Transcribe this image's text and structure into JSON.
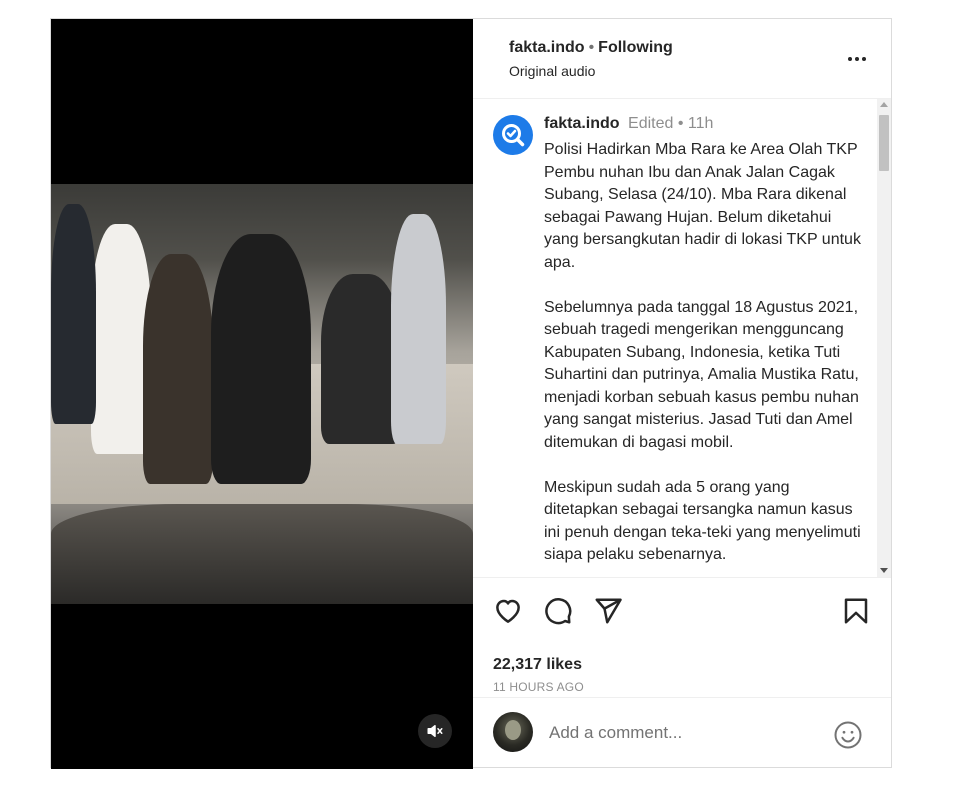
{
  "post": {
    "username": "fakta.indo",
    "follow_status": "Following",
    "separator": "•",
    "audio": "Original audio",
    "caption_edited": "Edited",
    "caption_time": "11h",
    "caption_paragraphs": [
      "Polisi Hadirkan Mba Rara ke Area Olah TKP Pembu nuhan Ibu dan Anak Jalan Cagak Subang, Selasa (24/10). Mba Rara dikenal sebagai Pawang Hujan. Belum diketahui yang bersangkutan hadir di lokasi TKP untuk apa.",
      "Sebelumnya pada tanggal 18 Agustus 2021, sebuah tragedi mengerikan mengguncang Kabupaten Subang, Indonesia, ketika Tuti Suhartini dan putrinya, Amalia Mustika Ratu, menjadi korban sebuah kasus pembu nuhan yang sangat misterius. Jasad Tuti dan Amel ditemukan di bagasi mobil.",
      "Meskipun sudah ada 5 orang yang ditetapkan sebagai tersangka namun kasus ini penuh dengan teka-teki yang menyelimuti siapa pelaku sebenarnya."
    ],
    "likes": "22,317 likes",
    "posted_ago": "11 HOURS AGO"
  },
  "comment": {
    "placeholder": "Add a comment..."
  },
  "icons": {
    "more": "more-horizontal-icon",
    "like": "heart-icon",
    "comment": "comment-bubble-icon",
    "share": "paper-plane-icon",
    "save": "bookmark-icon",
    "mute": "speaker-muted-icon",
    "emoji": "emoji-smiley-icon"
  },
  "colors": {
    "brand_avatar": "#1d7be8",
    "text": "#262626",
    "muted": "#8e8e8e"
  }
}
